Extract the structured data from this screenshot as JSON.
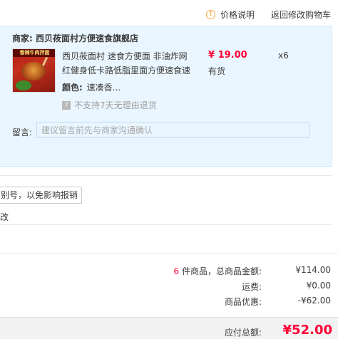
{
  "top": {
    "price_info_label": "价格说明",
    "back_to_cart_label": "返回修改购物车"
  },
  "order": {
    "shop_label": "商家:",
    "shop_name": "西贝莜面村方便速食旗舰店",
    "product": {
      "thumb_text": "香辣牛肉拌面",
      "title": "西贝莜面村 速食方便面 非油炸网红健身低卡路低脂里面方便速食速",
      "color_label": "颜色:",
      "color_value": "速凑香...",
      "price": "¥ 19.00",
      "stock": "有货",
      "quantity": "x6",
      "no_return_icon": "7",
      "no_return_text": "不支持7天无理由退货"
    },
    "message_label": "留言:",
    "message_placeholder": "建议留言前先与商家沟通确认"
  },
  "invoice": {
    "tip_text": "别号，以免影响报销",
    "link_text": "改"
  },
  "summary": {
    "count": "6",
    "count_suffix": " 件商品，总商品金额:",
    "goods_amount": "¥114.00",
    "shipping_label": "运费:",
    "shipping_amount": "¥0.00",
    "discount_label": "商品优惠:",
    "discount_amount": "-¥62.00",
    "total_label": "应付总额:",
    "total_amount": "¥52.00"
  },
  "colors": {
    "accent_red": "#ff0036",
    "info_orange": "#f3a73f",
    "panel_blue": "#eaf6ff"
  },
  "icons": [
    "info-icon",
    "no-return-icon"
  ]
}
